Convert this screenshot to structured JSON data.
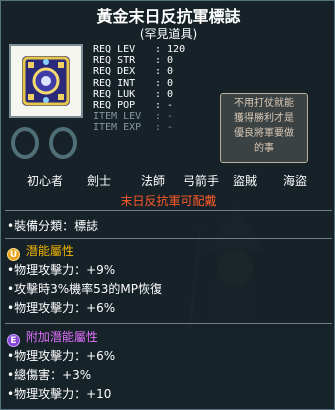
{
  "tooltip": {
    "title": "黃金末日反抗軍標誌",
    "rarity": "(罕見道具)",
    "item_icon": "gold-resistance-emblem-icon",
    "requirements": [
      {
        "key": "REQ LEV",
        "value": ": 120",
        "dim": false
      },
      {
        "key": "REQ STR",
        "value": ": 0",
        "dim": false
      },
      {
        "key": "REQ DEX",
        "value": ": 0",
        "dim": false
      },
      {
        "key": "REQ INT",
        "value": ": 0",
        "dim": false
      },
      {
        "key": "REQ LUK",
        "value": ": 0",
        "dim": false
      },
      {
        "key": "REQ POP",
        "value": ": -",
        "dim": false
      },
      {
        "key": "ITEM LEV",
        "value": ": -",
        "dim": true
      },
      {
        "key": "ITEM EXP",
        "value": ": -",
        "dim": true
      }
    ],
    "background_note": "不用打仗就能\n獲得勝利才是\n優良將軍要做\n的事",
    "jobs": [
      "初心者",
      "劍士",
      "法師",
      "弓箭手",
      "盜賊",
      "海盜"
    ],
    "event_text": "末日反抗軍可配戴",
    "category": "•裝備分類：標誌",
    "potential": {
      "badge": "U",
      "title": "潛能屬性",
      "lines": [
        "•物理攻擊力：+9%",
        "•攻擊時3%機率53的MP恢復",
        "•物理攻擊力：+6%"
      ]
    },
    "bonus_potential": {
      "badge": "E",
      "title": "附加潛能屬性",
      "lines": [
        "•物理攻擊力：+6%",
        "•總傷害：+3%",
        "•物理攻擊力：+10"
      ]
    }
  },
  "colors": {
    "title": "#ffffff",
    "event": "#ff5a28",
    "potential_label": "#f0b400",
    "bonus_label": "#e070ff",
    "panel": "#142026"
  }
}
